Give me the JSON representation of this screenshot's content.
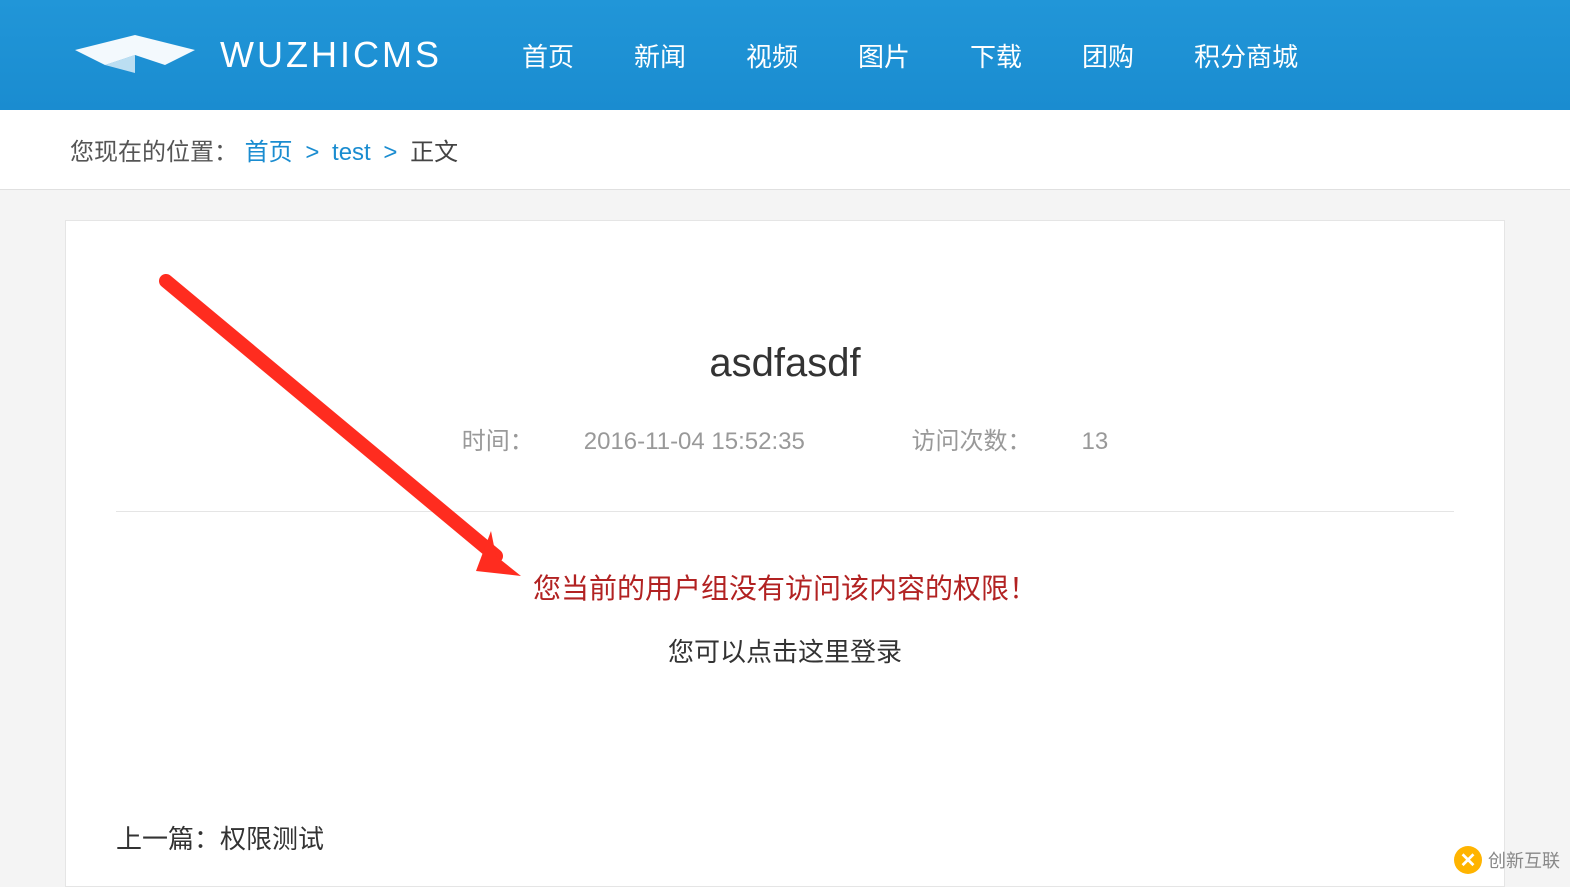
{
  "header": {
    "logo_text": "WUZHICMS",
    "nav": [
      "首页",
      "新闻",
      "视频",
      "图片",
      "下载",
      "团购",
      "积分商城"
    ]
  },
  "breadcrumb": {
    "prefix": "您现在的位置：",
    "items": [
      "首页",
      "test"
    ],
    "current": "正文"
  },
  "article": {
    "title": "asdfasdf",
    "time_label": "时间：",
    "time_value": "2016-11-04 15:52:35",
    "visits_label": "访问次数：",
    "visits_value": "13",
    "error_message": "您当前的用户组没有访问该内容的权限！",
    "login_hint": "您可以点击这里登录",
    "prev_label": "上一篇：",
    "prev_title": "权限测试"
  },
  "watermark": {
    "text": "创新互联"
  }
}
